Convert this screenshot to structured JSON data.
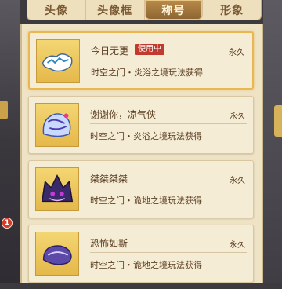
{
  "tabs": [
    {
      "label": "头像"
    },
    {
      "label": "头像框"
    },
    {
      "label": "称号",
      "active": true
    },
    {
      "label": "形象"
    }
  ],
  "titles": [
    {
      "name": "今日无更",
      "tag": "使用中",
      "duration": "永久",
      "source": "时空之门・炎浴之境玩法获得",
      "icon": "title-badge-icon",
      "selected": true
    },
    {
      "name": "谢谢你，凉气侠",
      "tag": "",
      "duration": "永久",
      "source": "时空之门・炎浴之境玩法获得",
      "icon": "title-badge-icon",
      "selected": false
    },
    {
      "name": "桀桀桀桀",
      "tag": "",
      "duration": "永久",
      "source": "时空之门・诡地之境玩法获得",
      "icon": "title-badge-icon",
      "selected": false
    },
    {
      "name": "恐怖如斯",
      "tag": "",
      "duration": "永久",
      "source": "时空之门・诡地之境玩法获得",
      "icon": "title-badge-icon",
      "selected": false
    }
  ],
  "side_badge": "1",
  "colors": {
    "panel_bg": "#efe3c6",
    "card_bg": "#f5ecd5",
    "accent_gold": "#e9b74f",
    "tag_red": "#c23a2e",
    "text_brown": "#5b3e22"
  }
}
